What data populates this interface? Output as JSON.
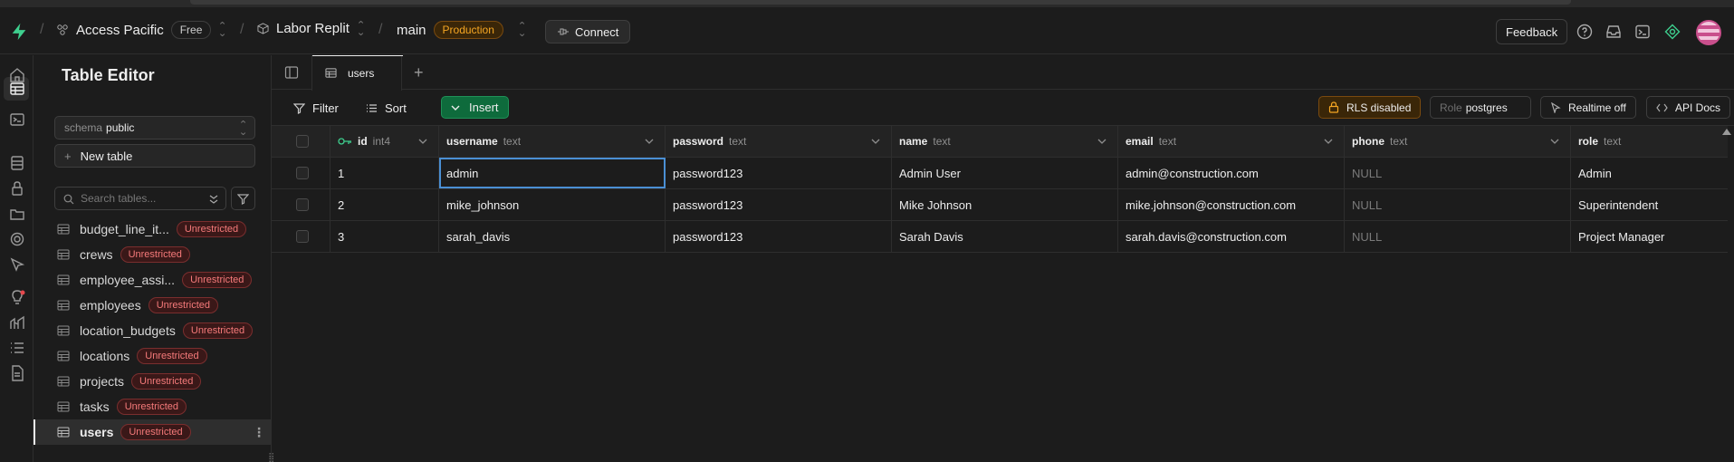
{
  "topnav": {
    "org": "Access Pacific",
    "plan": "Free",
    "project": "Labor Replit",
    "branch": "main",
    "env": "Production",
    "connect": "Connect",
    "feedback": "Feedback"
  },
  "sidebar": {
    "title": "Table Editor",
    "schema_label": "schema",
    "schema_value": "public",
    "new_table": "New table",
    "search_placeholder": "Search tables...",
    "tables": [
      {
        "name": "budget_line_it...",
        "badge": "Unrestricted"
      },
      {
        "name": "crews",
        "badge": "Unrestricted"
      },
      {
        "name": "employee_assi...",
        "badge": "Unrestricted"
      },
      {
        "name": "employees",
        "badge": "Unrestricted"
      },
      {
        "name": "location_budgets",
        "badge": "Unrestricted"
      },
      {
        "name": "locations",
        "badge": "Unrestricted"
      },
      {
        "name": "projects",
        "badge": "Unrestricted"
      },
      {
        "name": "tasks",
        "badge": "Unrestricted"
      },
      {
        "name": "users",
        "badge": "Unrestricted"
      }
    ]
  },
  "tabs": {
    "active": "users"
  },
  "toolbar": {
    "filter": "Filter",
    "sort": "Sort",
    "insert": "Insert",
    "rls": "RLS disabled",
    "role_label": "Role",
    "role_value": "postgres",
    "realtime": "Realtime off",
    "api_docs": "API Docs"
  },
  "grid": {
    "columns": [
      {
        "name": "id",
        "type": "int4"
      },
      {
        "name": "username",
        "type": "text"
      },
      {
        "name": "password",
        "type": "text"
      },
      {
        "name": "name",
        "type": "text"
      },
      {
        "name": "email",
        "type": "text"
      },
      {
        "name": "phone",
        "type": "text"
      },
      {
        "name": "role",
        "type": "text"
      }
    ],
    "rows": [
      [
        "1",
        "admin",
        "password123",
        "Admin User",
        "admin@construction.com",
        "NULL",
        "Admin"
      ],
      [
        "2",
        "mike_johnson",
        "password123",
        "Mike Johnson",
        "mike.johnson@construction.com",
        "NULL",
        "Superintendent"
      ],
      [
        "3",
        "sarah_davis",
        "password123",
        "Sarah Davis",
        "sarah.davis@construction.com",
        "NULL",
        "Project Manager"
      ]
    ]
  }
}
